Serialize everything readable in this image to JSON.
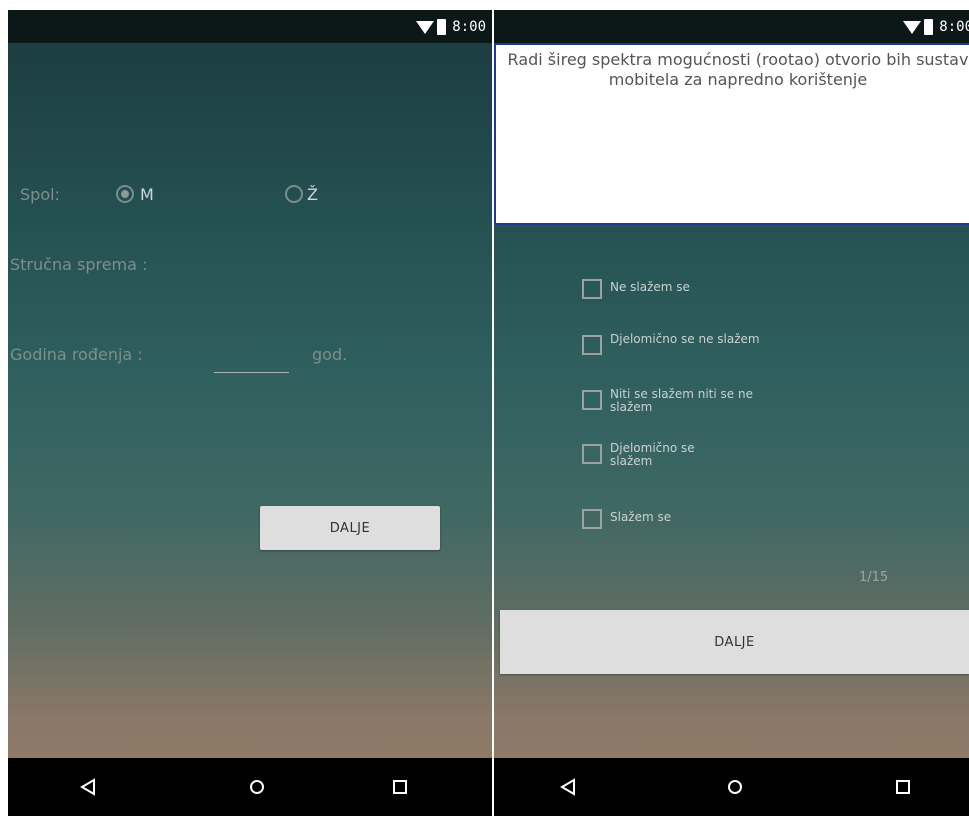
{
  "status_bar": {
    "time": "8:00"
  },
  "left_screen": {
    "gender_label": "Spol:",
    "gender_options": [
      {
        "label": "M",
        "checked": true
      },
      {
        "label": "Ž",
        "checked": false
      }
    ],
    "education_label": "Stručna sprema :",
    "birth_year_label": "Godina rođenja :",
    "year_value": "",
    "year_unit": "god.",
    "next_button": "DALJE"
  },
  "right_screen": {
    "question": "Radi šireg spektra mogućnosti (rootao) otvorio bih sustav mobitela za napredno korištenje",
    "options": [
      {
        "label": "Ne slažem se"
      },
      {
        "label": "Djelomično se ne slažem"
      },
      {
        "label": "Niti se slažem niti se ne slažem"
      },
      {
        "label": "Djelomično se slažem"
      },
      {
        "label": "Slažem se"
      }
    ],
    "progress": "1/15",
    "next_button": "DALJE"
  },
  "nav_icons": [
    "back-icon",
    "home-icon",
    "recent-apps-icon"
  ],
  "colors": {
    "status_bar": "#0c1818",
    "nav_bar": "#000000",
    "button": "#dedede",
    "question_border": "#1e3a8a"
  }
}
